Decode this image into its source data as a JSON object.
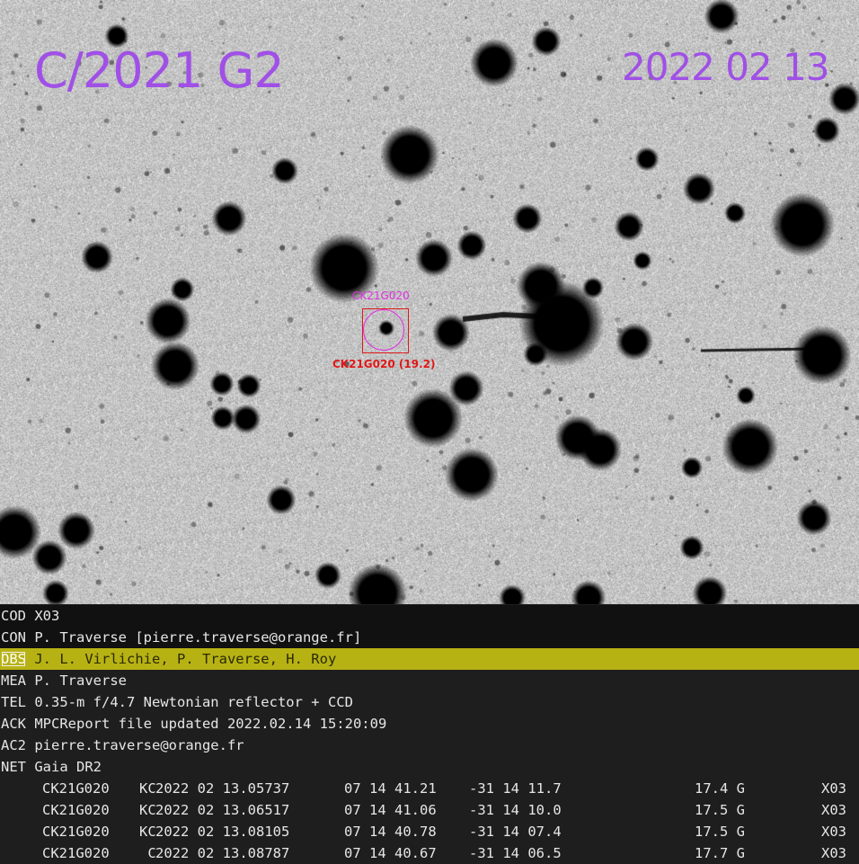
{
  "overlay": {
    "object": "C/2021 G2",
    "date": "2022 02 13",
    "predicted_label": "CK21G020",
    "measured_label": "CK21G020 (19.2)",
    "title_color": "#a050e6",
    "predicted_color": "#e030e0",
    "measured_color": "#e01818"
  },
  "report": {
    "header_lines": [
      {
        "key": "COD",
        "value": "X03"
      },
      {
        "key": "CON",
        "value": "P. Traverse [pierre.traverse@orange.fr]"
      },
      {
        "key": "OBS",
        "value": "J. L. Virlichie, P. Traverse, H. Roy"
      },
      {
        "key": "MEA",
        "value": "P. Traverse"
      },
      {
        "key": "TEL",
        "value": "0.35-m f/4.7 Newtonian reflector + CCD"
      },
      {
        "key": "ACK",
        "value": "MPCReport file updated 2022.02.14 15:20:09"
      },
      {
        "key": "AC2",
        "value": "pierre.traverse@orange.fr"
      },
      {
        "key": "NET",
        "value": "Gaia DR2"
      }
    ],
    "highlight_color": "#b7b214",
    "observations": [
      {
        "designation": "CK21G020",
        "note": "KC",
        "date": "2022 02 13.05737",
        "ra": "07 14 41.21",
        "dec": "-31 14 11.7",
        "mag": "17.4 G",
        "code": "X03"
      },
      {
        "designation": "CK21G020",
        "note": "KC",
        "date": "2022 02 13.06517",
        "ra": "07 14 41.06",
        "dec": "-31 14 10.0",
        "mag": "17.5 G",
        "code": "X03"
      },
      {
        "designation": "CK21G020",
        "note": "KC",
        "date": "2022 02 13.08105",
        "ra": "07 14 40.78",
        "dec": "-31 14 07.4",
        "mag": "17.5 G",
        "code": "X03"
      },
      {
        "designation": "CK21G020",
        "note": " C",
        "date": "2022 02 13.08787",
        "ra": "07 14 40.67",
        "dec": "-31 14 06.5",
        "mag": "17.7 G",
        "code": "X03"
      }
    ]
  }
}
